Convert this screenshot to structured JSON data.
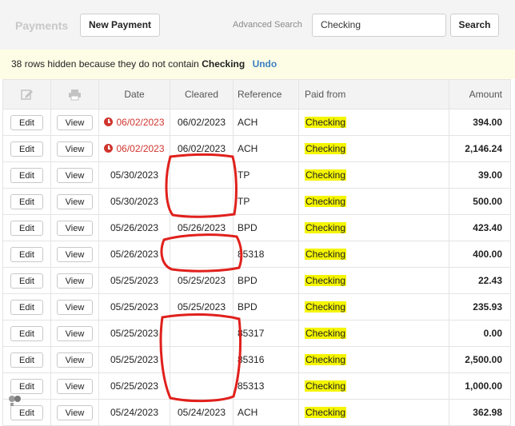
{
  "header": {
    "title": "Payments",
    "new_payment_label": "New Payment",
    "advanced_search_label": "Advanced Search",
    "search_value": "Checking",
    "search_button_label": "Search"
  },
  "notice": {
    "count": "38",
    "message": "rows hidden because they do not contain",
    "keyword": "Checking",
    "undo_label": "Undo"
  },
  "table": {
    "columns": {
      "edit_icon": "edit-icon",
      "print_icon": "print-icon",
      "date": "Date",
      "cleared": "Cleared",
      "reference": "Reference",
      "paid_from": "Paid from",
      "amount": "Amount"
    },
    "edit_label": "Edit",
    "view_label": "View",
    "rows": [
      {
        "date": "06/02/2023",
        "overdue": true,
        "cleared": "06/02/2023",
        "reference": "ACH",
        "paid_from": "Checking",
        "amount": "394.00"
      },
      {
        "date": "06/02/2023",
        "overdue": true,
        "cleared": "06/02/2023",
        "reference": "ACH",
        "paid_from": "Checking",
        "amount": "2,146.24"
      },
      {
        "date": "05/30/2023",
        "overdue": false,
        "cleared": "",
        "reference": "TP",
        "paid_from": "Checking",
        "amount": "39.00"
      },
      {
        "date": "05/30/2023",
        "overdue": false,
        "cleared": "",
        "reference": "TP",
        "paid_from": "Checking",
        "amount": "500.00"
      },
      {
        "date": "05/26/2023",
        "overdue": false,
        "cleared": "05/26/2023",
        "reference": "BPD",
        "paid_from": "Checking",
        "amount": "423.40"
      },
      {
        "date": "05/26/2023",
        "overdue": false,
        "cleared": "",
        "reference": "85318",
        "paid_from": "Checking",
        "amount": "400.00"
      },
      {
        "date": "05/25/2023",
        "overdue": false,
        "cleared": "05/25/2023",
        "reference": "BPD",
        "paid_from": "Checking",
        "amount": "22.43"
      },
      {
        "date": "05/25/2023",
        "overdue": false,
        "cleared": "05/25/2023",
        "reference": "BPD",
        "paid_from": "Checking",
        "amount": "235.93"
      },
      {
        "date": "05/25/2023",
        "overdue": false,
        "cleared": "",
        "reference": "85317",
        "paid_from": "Checking",
        "amount": "0.00"
      },
      {
        "date": "05/25/2023",
        "overdue": false,
        "cleared": "",
        "reference": "85316",
        "paid_from": "Checking",
        "amount": "2,500.00"
      },
      {
        "date": "05/25/2023",
        "overdue": false,
        "cleared": "",
        "reference": "85313",
        "paid_from": "Checking",
        "amount": "1,000.00"
      },
      {
        "date": "05/24/2023",
        "overdue": false,
        "cleared": "05/24/2023",
        "reference": "ACH",
        "paid_from": "Checking",
        "amount": "362.98"
      }
    ]
  },
  "colors": {
    "highlight": "#f5f500",
    "overdue": "#d0362f",
    "link": "#3d7fbf",
    "annotation": "#e0201c"
  }
}
